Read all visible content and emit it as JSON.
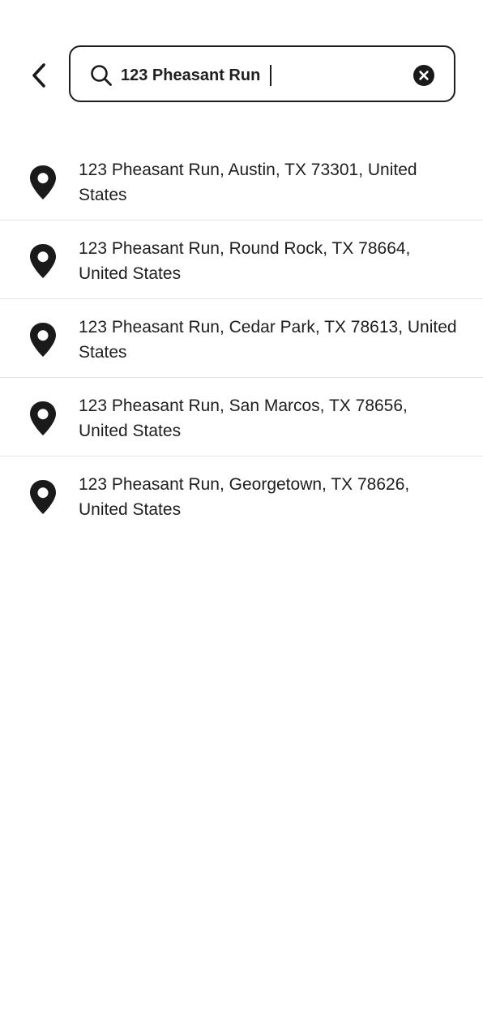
{
  "header": {
    "back_icon": "chevron-left-icon",
    "search": {
      "icon": "search-icon",
      "value": "123 Pheasant Run",
      "clear_icon": "clear-circle-icon"
    }
  },
  "results": [
    {
      "icon": "location-pin-icon",
      "address": "123 Pheasant Run, Austin, TX 73301, United States"
    },
    {
      "icon": "location-pin-icon",
      "address": "123 Pheasant Run, Round Rock, TX 78664, United States"
    },
    {
      "icon": "location-pin-icon",
      "address": "123 Pheasant Run, Cedar Park, TX 78613, United States"
    },
    {
      "icon": "location-pin-icon",
      "address": "123 Pheasant Run, San Marcos, TX 78656, United States"
    },
    {
      "icon": "location-pin-icon",
      "address": "123 Pheasant Run, Georgetown, TX 78626, United States"
    }
  ],
  "colors": {
    "text": "#1e1e1e",
    "border": "#1d1d1d",
    "divider": "#e3e3e3",
    "background": "#ffffff"
  }
}
